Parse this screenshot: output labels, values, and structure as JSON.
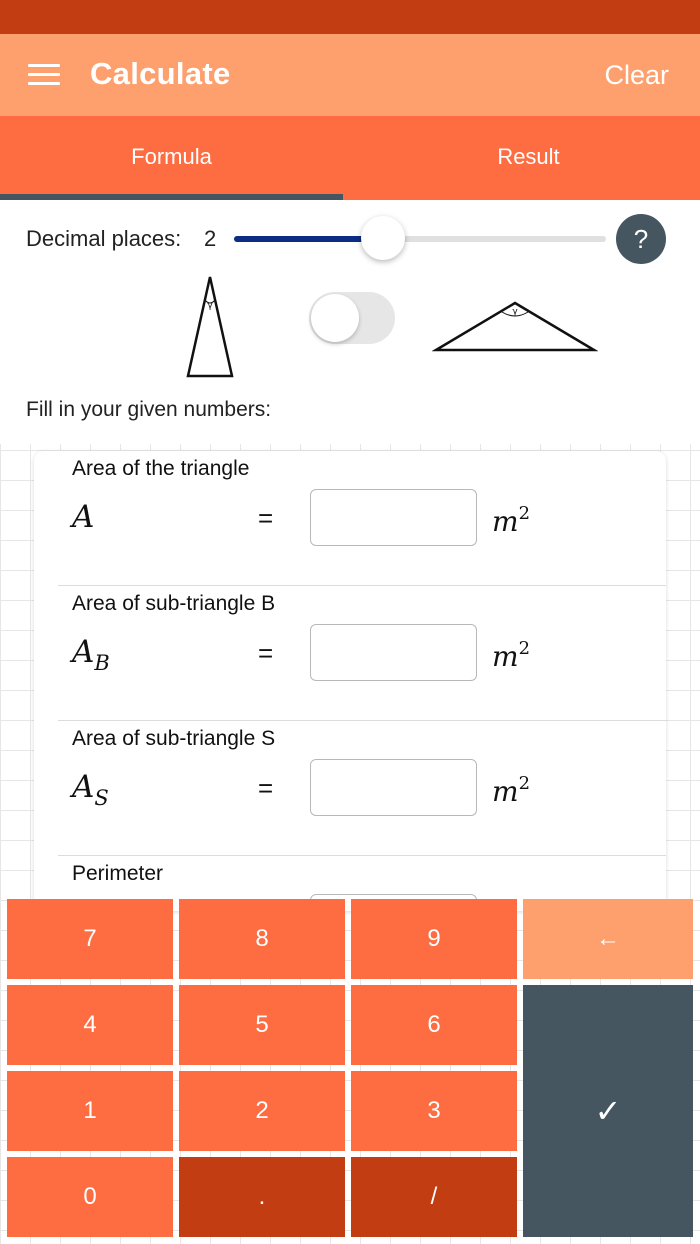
{
  "colors": {
    "status_bar": "#c23d12",
    "app_bar": "#fda06e",
    "tabs": "#fe6d42",
    "indicator": "#455660",
    "key": "#fe6d42",
    "key_dark": "#c23d12",
    "key_light": "#fda06e",
    "enter_key": "#455660",
    "slider_fill": "#0d2c84"
  },
  "header": {
    "title": "Calculate",
    "clear": "Clear",
    "menu_icon": "hamburger-menu-icon"
  },
  "tabs": [
    {
      "label": "Formula",
      "selected": true
    },
    {
      "label": "Result",
      "selected": false
    }
  ],
  "settings": {
    "decimal_label": "Decimal places:",
    "decimal_value": "2",
    "slider_fraction": 0.4,
    "help": "?",
    "angle_symbol": "γ",
    "triangle_toggle_on": false,
    "fill_label": "Fill in your given numbers:"
  },
  "fields": [
    {
      "title": "Area of the triangle",
      "var": "A",
      "sub": "",
      "eq": "=",
      "value": "",
      "unit": "m",
      "unit_exp": "2"
    },
    {
      "title": "Area of sub-triangle B",
      "var": "A",
      "sub": "B",
      "eq": "=",
      "value": "",
      "unit": "m",
      "unit_exp": "2"
    },
    {
      "title": "Area of sub-triangle S",
      "var": "A",
      "sub": "S",
      "eq": "=",
      "value": "",
      "unit": "m",
      "unit_exp": "2"
    },
    {
      "title": "Perimeter",
      "var": "",
      "sub": "",
      "eq": "",
      "value": "",
      "unit": "",
      "unit_exp": ""
    }
  ],
  "keypad": {
    "k7": "7",
    "k8": "8",
    "k9": "9",
    "back": "←",
    "k4": "4",
    "k5": "5",
    "k6": "6",
    "k1": "1",
    "k2": "2",
    "k3": "3",
    "k0": "0",
    "dot": ".",
    "slash": "/",
    "enter": "✓"
  }
}
